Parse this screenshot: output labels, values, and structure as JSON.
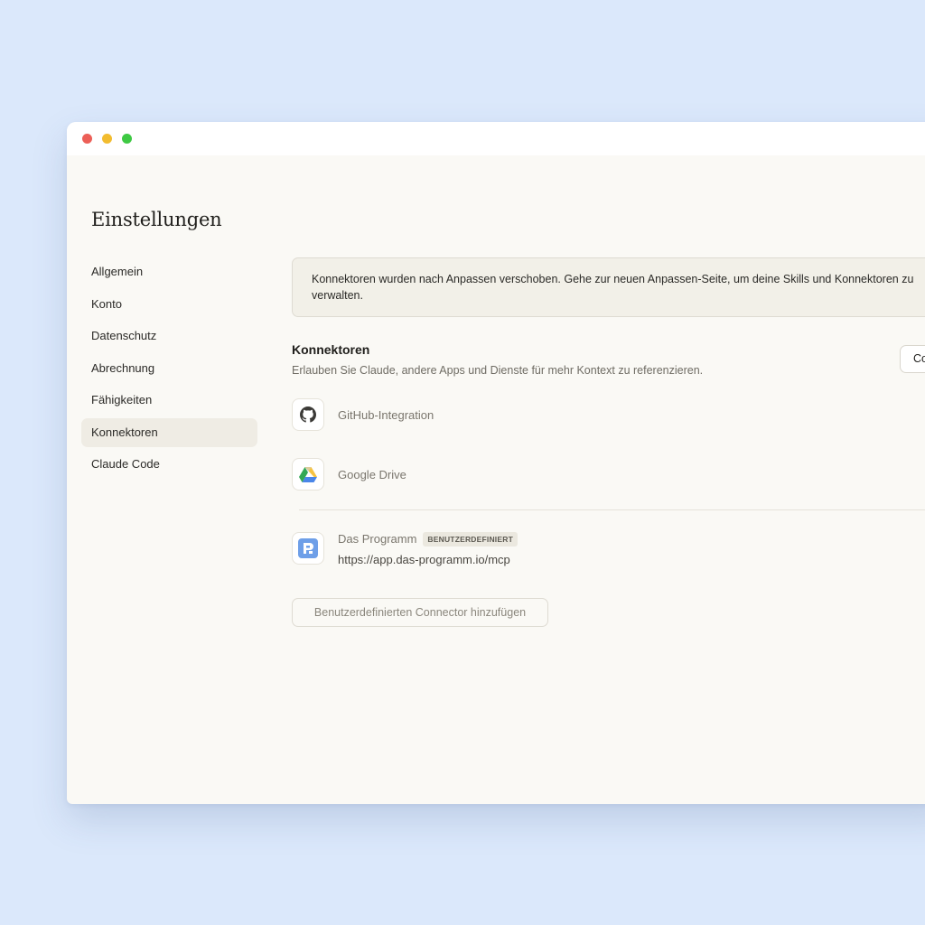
{
  "page": {
    "title": "Einstellungen"
  },
  "sidebar": {
    "items": [
      {
        "label": "Allgemein"
      },
      {
        "label": "Konto"
      },
      {
        "label": "Datenschutz"
      },
      {
        "label": "Abrechnung"
      },
      {
        "label": "Fähigkeiten"
      },
      {
        "label": "Konnektoren"
      },
      {
        "label": "Claude Code"
      }
    ],
    "active_item": "Konnektoren"
  },
  "notice": {
    "text": "Konnektoren wurden nach Anpassen verschoben. Gehe zur neuen Anpassen-Seite, um deine Skills und Konnektoren zu verwalten."
  },
  "connectors_section": {
    "title": "Konnektoren",
    "description": "Erlauben Sie Claude, andere Apps und Dienste für mehr Kontext zu referenzieren.",
    "button_label": "Co",
    "items": [
      {
        "name": "GitHub-Integration",
        "icon": "github-icon"
      },
      {
        "name": "Google Drive",
        "icon": "google-drive-icon"
      }
    ],
    "custom_items": [
      {
        "name": "Das Programm",
        "badge": "BENUTZERDEFINIERT",
        "url": "https://app.das-programm.io/mcp",
        "icon": "das-programm-icon"
      }
    ],
    "add_button_label": "Benutzerdefinierten Connector hinzufügen"
  },
  "colors": {
    "background": "#dbe8fb",
    "window": "#faf9f5",
    "active_nav": "#efece4"
  }
}
